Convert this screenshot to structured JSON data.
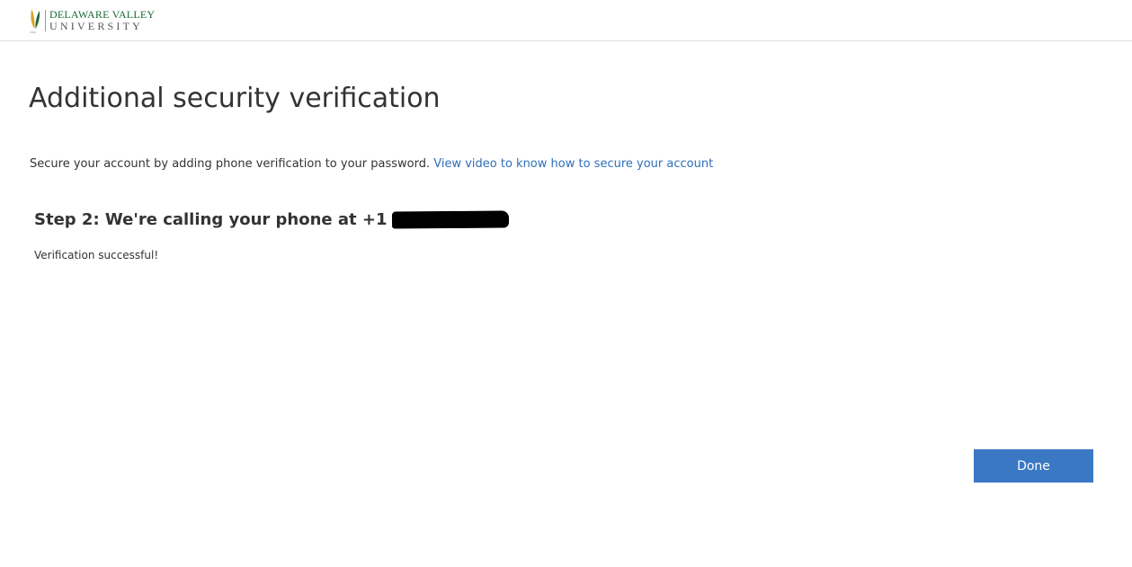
{
  "header": {
    "logo": {
      "name_line1": "DELAWARE VALLEY",
      "name_line2": "UNIVERSITY",
      "year": "1896"
    }
  },
  "main": {
    "title": "Additional security verification",
    "intro_text": "Secure your account by adding phone verification to your password.",
    "intro_link": "View video to know how to secure your account",
    "step_title": "Step 2: We're calling your phone at +1",
    "status_text": "Verification successful!",
    "done_label": "Done"
  },
  "colors": {
    "link": "#2f6fb8",
    "primary_button": "#3b78c4",
    "logo_green": "#1c6b38",
    "logo_gold": "#d8a52a"
  }
}
